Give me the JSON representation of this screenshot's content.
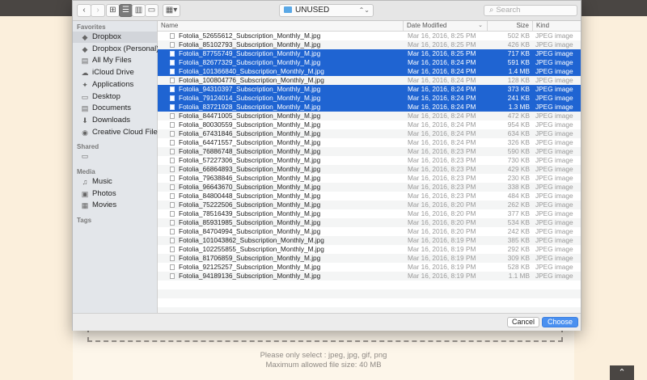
{
  "background": {
    "hint_line1": "Please only select : jpeg, jpg, gif, png",
    "hint_line2": "Maximum allowed file size: 40 MB",
    "scroll_top_glyph": "⌃"
  },
  "toolbar": {
    "back_glyph": "‹",
    "forward_glyph": "›",
    "view_icon_glyph": "⊞",
    "view_list_glyph": "☰",
    "view_column_glyph": "▥",
    "view_cover_glyph": "▭",
    "arrange_glyph": "▦▾",
    "location": "UNUSED",
    "location_updown": "⌃⌄",
    "search_placeholder": "Search",
    "search_glyph": "⌕"
  },
  "sidebar": {
    "favorites_label": "Favorites",
    "shared_label": "Shared",
    "media_label": "Media",
    "tags_label": "Tags",
    "favorites": [
      {
        "label": "Dropbox",
        "icon": "dropbox-icon",
        "glyph": "◆"
      },
      {
        "label": "Dropbox (Personal)",
        "icon": "dropbox-icon",
        "glyph": "◆"
      },
      {
        "label": "All My Files",
        "icon": "all-files-icon",
        "glyph": "▤"
      },
      {
        "label": "iCloud Drive",
        "icon": "cloud-icon",
        "glyph": "☁"
      },
      {
        "label": "Applications",
        "icon": "applications-icon",
        "glyph": "✦"
      },
      {
        "label": "Desktop",
        "icon": "desktop-icon",
        "glyph": "▭"
      },
      {
        "label": "Documents",
        "icon": "documents-icon",
        "glyph": "▤"
      },
      {
        "label": "Downloads",
        "icon": "downloads-icon",
        "glyph": "⬇"
      },
      {
        "label": "Creative Cloud Files",
        "icon": "creative-cloud-icon",
        "glyph": "◉"
      }
    ],
    "shared_glyph": "▭",
    "media": [
      {
        "label": "Music",
        "icon": "music-icon",
        "glyph": "♫"
      },
      {
        "label": "Photos",
        "icon": "photos-icon",
        "glyph": "▣"
      },
      {
        "label": "Movies",
        "icon": "movies-icon",
        "glyph": "▦"
      }
    ]
  },
  "list_header": {
    "name": "Name",
    "date": "Date Modified",
    "date_chevron": "⌄",
    "size": "Size",
    "kind": "Kind"
  },
  "files": [
    {
      "name": "Fotolia_52655612_Subscription_Monthly_M.jpg",
      "date": "Mar 16, 2016, 8:25 PM",
      "size": "502 KB",
      "kind": "JPEG image",
      "selected": false
    },
    {
      "name": "Fotolia_85102793_Subscription_Monthly_M.jpg",
      "date": "Mar 16, 2016, 8:25 PM",
      "size": "426 KB",
      "kind": "JPEG image",
      "selected": false
    },
    {
      "name": "Fotolia_87755749_Subscription_Monthly_M.jpg",
      "date": "Mar 16, 2016, 8:25 PM",
      "size": "717 KB",
      "kind": "JPEG image",
      "selected": true
    },
    {
      "name": "Fotolia_82677329_Subscription_Monthly_M.jpg",
      "date": "Mar 16, 2016, 8:24 PM",
      "size": "591 KB",
      "kind": "JPEG image",
      "selected": true
    },
    {
      "name": "Fotolia_101366840_Subscription_Monthly_M.jpg",
      "date": "Mar 16, 2016, 8:24 PM",
      "size": "1.4 MB",
      "kind": "JPEG image",
      "selected": true
    },
    {
      "name": "Fotolia_100804776_Subscription_Monthly_M.jpg",
      "date": "Mar 16, 2016, 8:24 PM",
      "size": "128 KB",
      "kind": "JPEG image",
      "selected": false
    },
    {
      "name": "Fotolia_94310397_Subscription_Monthly_M.jpg",
      "date": "Mar 16, 2016, 8:24 PM",
      "size": "373 KB",
      "kind": "JPEG image",
      "selected": true
    },
    {
      "name": "Fotolia_79124014_Subscription_Monthly_M.jpg",
      "date": "Mar 16, 2016, 8:24 PM",
      "size": "241 KB",
      "kind": "JPEG image",
      "selected": true
    },
    {
      "name": "Fotolia_83721928_Subscription_Monthly_M.jpg",
      "date": "Mar 16, 2016, 8:24 PM",
      "size": "1.3 MB",
      "kind": "JPEG image",
      "selected": true
    },
    {
      "name": "Fotolia_84471005_Subscription_Monthly_M.jpg",
      "date": "Mar 16, 2016, 8:24 PM",
      "size": "472 KB",
      "kind": "JPEG image",
      "selected": false
    },
    {
      "name": "Fotolia_80030559_Subscription_Monthly_M.jpg",
      "date": "Mar 16, 2016, 8:24 PM",
      "size": "954 KB",
      "kind": "JPEG image",
      "selected": false
    },
    {
      "name": "Fotolia_67431846_Subscription_Monthly_M.jpg",
      "date": "Mar 16, 2016, 8:24 PM",
      "size": "634 KB",
      "kind": "JPEG image",
      "selected": false
    },
    {
      "name": "Fotolia_64471557_Subscription_Monthly_M.jpg",
      "date": "Mar 16, 2016, 8:24 PM",
      "size": "326 KB",
      "kind": "JPEG image",
      "selected": false
    },
    {
      "name": "Fotolia_76886748_Subscription_Monthly_M.jpg",
      "date": "Mar 16, 2016, 8:23 PM",
      "size": "590 KB",
      "kind": "JPEG image",
      "selected": false
    },
    {
      "name": "Fotolia_57227306_Subscription_Monthly_M.jpg",
      "date": "Mar 16, 2016, 8:23 PM",
      "size": "730 KB",
      "kind": "JPEG image",
      "selected": false
    },
    {
      "name": "Fotolia_66864893_Subscription_Monthly_M.jpg",
      "date": "Mar 16, 2016, 8:23 PM",
      "size": "429 KB",
      "kind": "JPEG image",
      "selected": false
    },
    {
      "name": "Fotolia_79638846_Subscription_Monthly_M.jpg",
      "date": "Mar 16, 2016, 8:23 PM",
      "size": "230 KB",
      "kind": "JPEG image",
      "selected": false
    },
    {
      "name": "Fotolia_96643670_Subscription_Monthly_M.jpg",
      "date": "Mar 16, 2016, 8:23 PM",
      "size": "338 KB",
      "kind": "JPEG image",
      "selected": false
    },
    {
      "name": "Fotolia_84800448_Subscription_Monthly_M.jpg",
      "date": "Mar 16, 2016, 8:23 PM",
      "size": "484 KB",
      "kind": "JPEG image",
      "selected": false
    },
    {
      "name": "Fotolia_75222506_Subscription_Monthly_M.jpg",
      "date": "Mar 16, 2016, 8:20 PM",
      "size": "262 KB",
      "kind": "JPEG image",
      "selected": false
    },
    {
      "name": "Fotolia_78516439_Subscription_Monthly_M.jpg",
      "date": "Mar 16, 2016, 8:20 PM",
      "size": "377 KB",
      "kind": "JPEG image",
      "selected": false
    },
    {
      "name": "Fotolia_85931985_Subscription_Monthly_M.jpg",
      "date": "Mar 16, 2016, 8:20 PM",
      "size": "534 KB",
      "kind": "JPEG image",
      "selected": false
    },
    {
      "name": "Fotolia_84704994_Subscription_Monthly_M.jpg",
      "date": "Mar 16, 2016, 8:20 PM",
      "size": "242 KB",
      "kind": "JPEG image",
      "selected": false
    },
    {
      "name": "Fotolia_101043862_Subscription_Monthly_M.jpg",
      "date": "Mar 16, 2016, 8:19 PM",
      "size": "385 KB",
      "kind": "JPEG image",
      "selected": false
    },
    {
      "name": "Fotolia_102255855_Subscription_Monthly_M.jpg",
      "date": "Mar 16, 2016, 8:19 PM",
      "size": "292 KB",
      "kind": "JPEG image",
      "selected": false
    },
    {
      "name": "Fotolia_81706859_Subscription_Monthly_M.jpg",
      "date": "Mar 16, 2016, 8:19 PM",
      "size": "309 KB",
      "kind": "JPEG image",
      "selected": false
    },
    {
      "name": "Fotolia_92125257_Subscription_Monthly_M.jpg",
      "date": "Mar 16, 2016, 8:19 PM",
      "size": "528 KB",
      "kind": "JPEG image",
      "selected": false
    },
    {
      "name": "Fotolia_94189136_Subscription_Monthly_M.jpg",
      "date": "Mar 16, 2016, 8:19 PM",
      "size": "1.1 MB",
      "kind": "JPEG image",
      "selected": false
    }
  ],
  "buttons": {
    "cancel": "Cancel",
    "choose": "Choose"
  },
  "colors": {
    "selection": "#1f64d2",
    "choose_button": "#4a90f0",
    "background_page": "#fbefdc"
  }
}
